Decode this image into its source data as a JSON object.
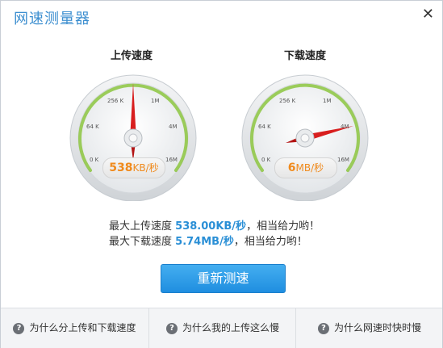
{
  "window": {
    "title": "网速测量器",
    "close_icon": "close-icon"
  },
  "gauges": [
    {
      "label": "上传速度",
      "ticks": [
        "256 K",
        "1M",
        "64 K",
        "4M",
        "0 K",
        "16M"
      ],
      "readout_value": "538",
      "readout_unit": "KB/秒"
    },
    {
      "label": "下载速度",
      "ticks": [
        "256 K",
        "1M",
        "64 K",
        "4M",
        "0 K",
        "16M"
      ],
      "readout_value": "6",
      "readout_unit": "MB/秒"
    }
  ],
  "stats": {
    "upload_prefix": "最大上传速度",
    "upload_value": "538.00KB/秒",
    "upload_suffix": "，相当给力哟！",
    "download_prefix": "最大下载速度",
    "download_value": "5.74MB/秒",
    "download_suffix": "，相当给力哟！"
  },
  "retest_button": "重新测速",
  "footer": {
    "links": [
      "为什么分上传和下载速度",
      "为什么我的上传这么慢",
      "为什么网速时快时慢"
    ]
  },
  "colors": {
    "accent": "#3d8fd0",
    "needle": "#d81e1e",
    "readout": "#f08a1c",
    "arc": "#8cc63f"
  }
}
